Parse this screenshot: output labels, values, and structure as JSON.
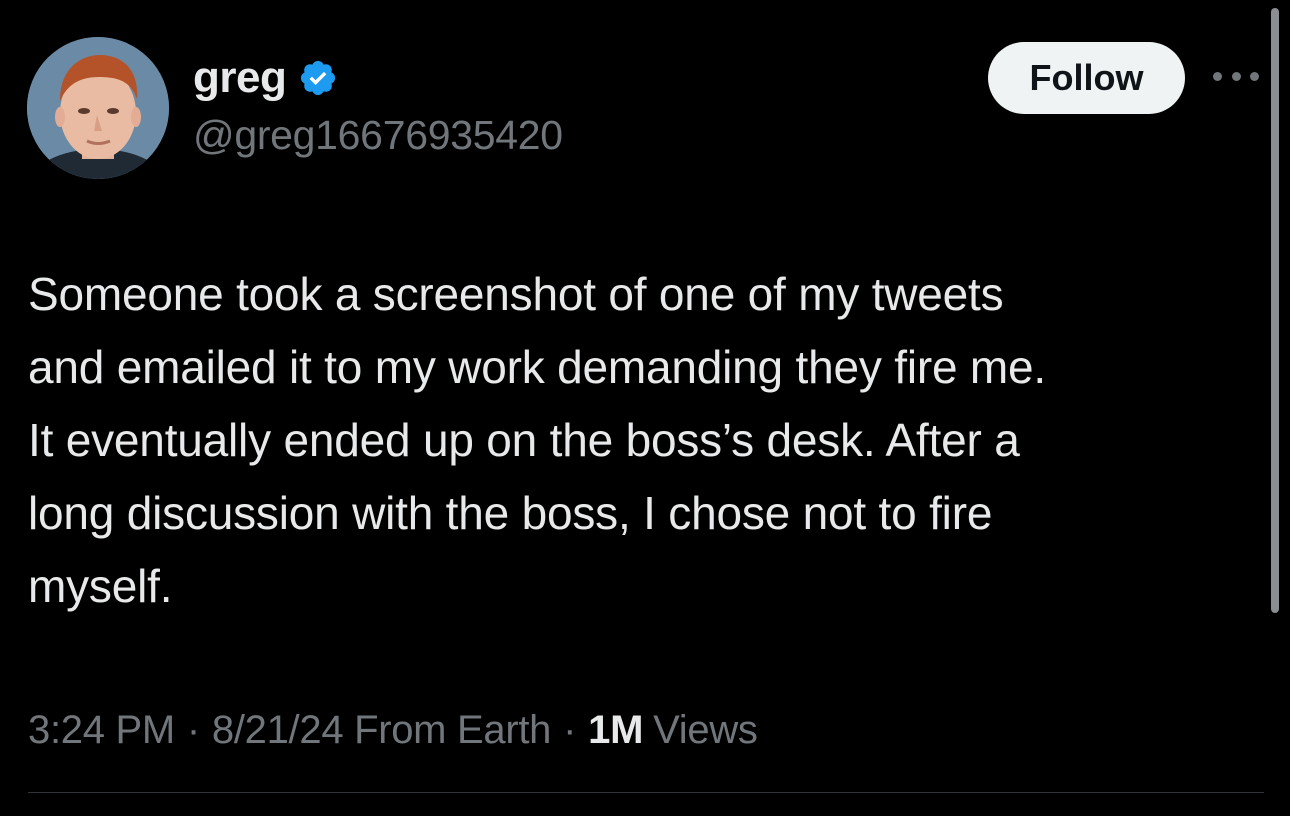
{
  "author": {
    "display_name": "greg",
    "handle": "@greg16676935420",
    "verified": true,
    "avatar_icon": "profile-photo"
  },
  "actions": {
    "follow_label": "Follow",
    "more_icon": "ellipsis-horizontal-icon"
  },
  "tweet": {
    "lines": [
      "Someone took a screenshot of one of my tweets",
      "and emailed it to my work demanding they fire me.",
      "It eventually ended up on the boss’s desk. After a",
      "long discussion with the boss, I chose not to fire",
      "myself."
    ]
  },
  "meta": {
    "time": "3:24 PM",
    "separator": "·",
    "date_source": "8/21/24 From Earth",
    "views_count": "1M",
    "views_label": "Views"
  },
  "colors": {
    "background": "#000000",
    "primary_text": "#e7e9ea",
    "secondary_text": "#71767b",
    "verified_blue": "#1d9bf0",
    "follow_button_bg": "#eff3f4",
    "divider": "#2f3336"
  }
}
